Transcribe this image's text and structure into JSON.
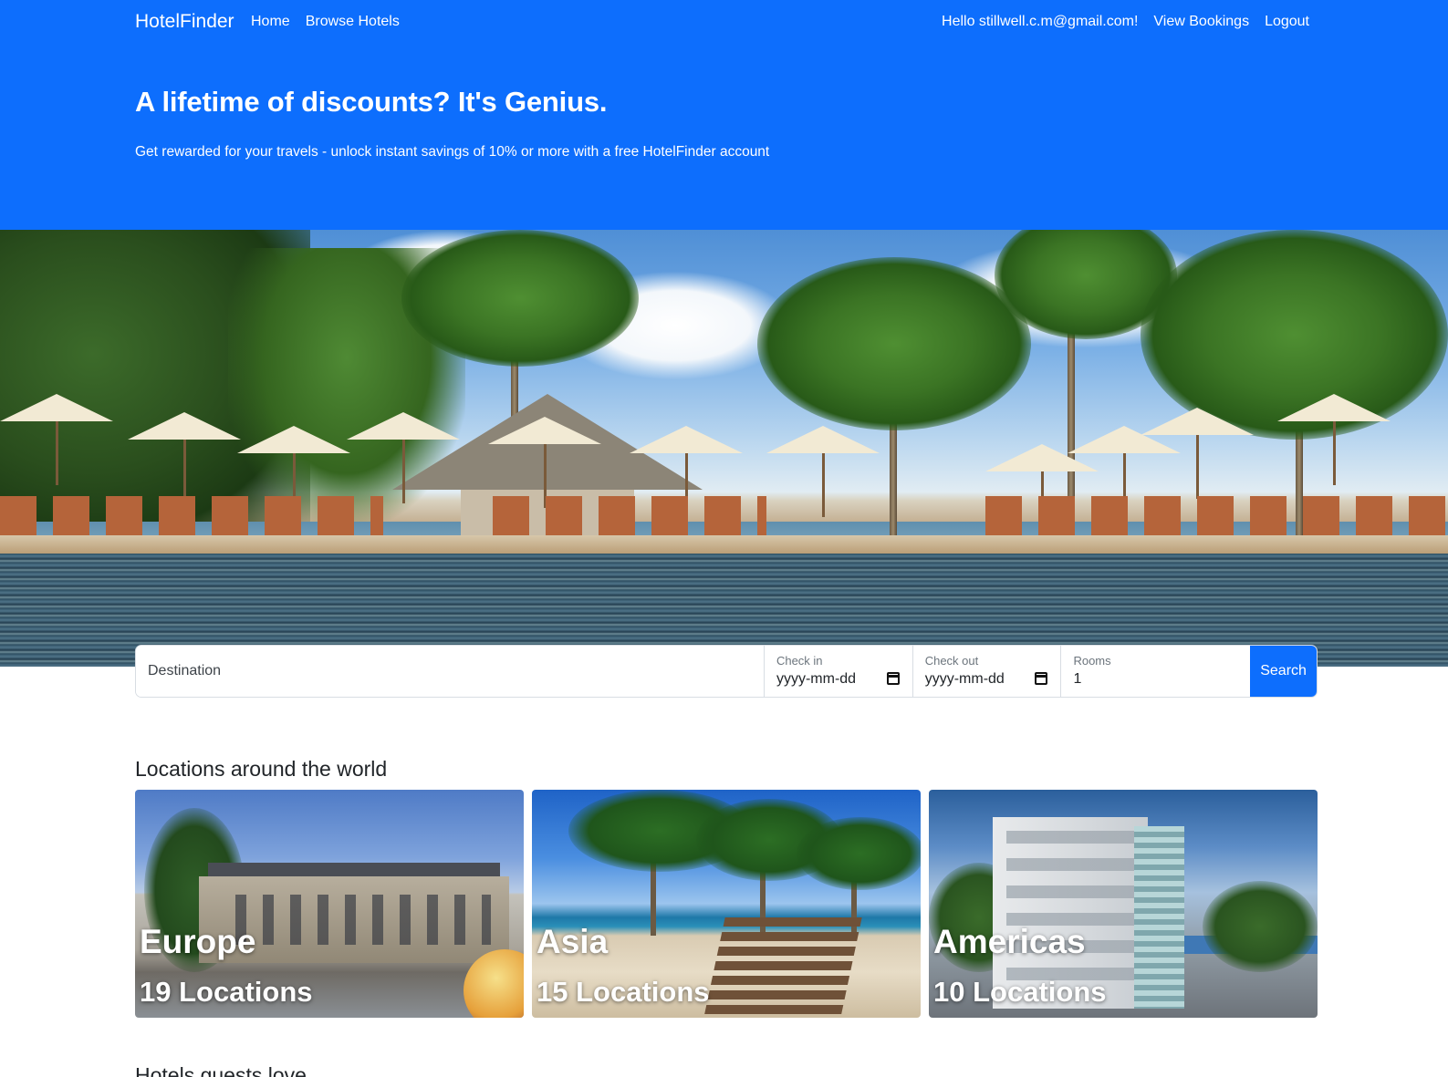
{
  "nav": {
    "brand": "HotelFinder",
    "links": [
      "Home",
      "Browse Hotels"
    ],
    "greeting": "Hello stillwell.c.m@gmail.com!",
    "view_bookings": "View Bookings",
    "logout": "Logout"
  },
  "hero": {
    "title": "A lifetime of discounts? It's Genius.",
    "subtitle": "Get rewarded for your travels - unlock instant savings of 10% or more with a free HotelFinder account"
  },
  "search": {
    "destination_placeholder": "Destination",
    "checkin_label": "Check in",
    "checkin_value": "yyyy-mm-dd",
    "checkout_label": "Check out",
    "checkout_value": "yyyy-mm-dd",
    "rooms_label": "Rooms",
    "rooms_value": "1",
    "button": "Search"
  },
  "locations": {
    "title": "Locations around the world",
    "cards": [
      {
        "name": "Europe",
        "count": "19 Locations"
      },
      {
        "name": "Asia",
        "count": "15 Locations"
      },
      {
        "name": "Americas",
        "count": "10 Locations"
      }
    ]
  },
  "hotels": {
    "title": "Hotels guests love"
  },
  "colors": {
    "primary": "#0d6efd",
    "text": "#212529",
    "muted": "#6c757d"
  },
  "icons": {
    "calendar": "calendar-icon"
  }
}
